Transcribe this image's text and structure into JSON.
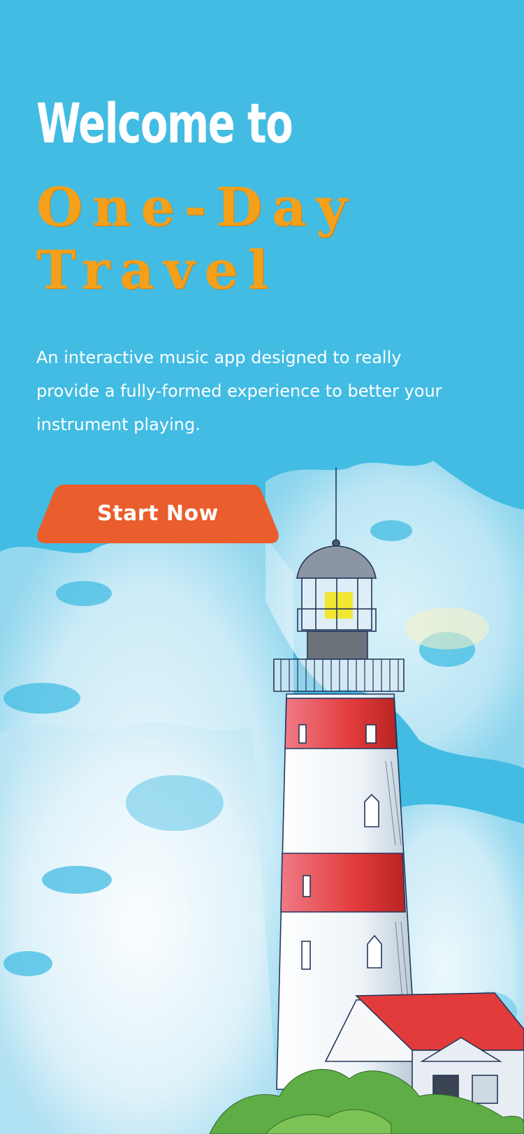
{
  "hero": {
    "title_line1": "Welcome to",
    "title_line2": "One-Day\nTravel",
    "description": "An interactive music app designed to really provide a fully-formed experience to better your instrument playing."
  },
  "cta": {
    "label": "Start Now"
  },
  "illustration": {
    "icon": "lighthouse-watercolor-illustration"
  },
  "colors": {
    "background": "#42bce3",
    "title_white": "#ffffff",
    "title_orange": "#f4a01a",
    "button": "#ea5d2c"
  }
}
